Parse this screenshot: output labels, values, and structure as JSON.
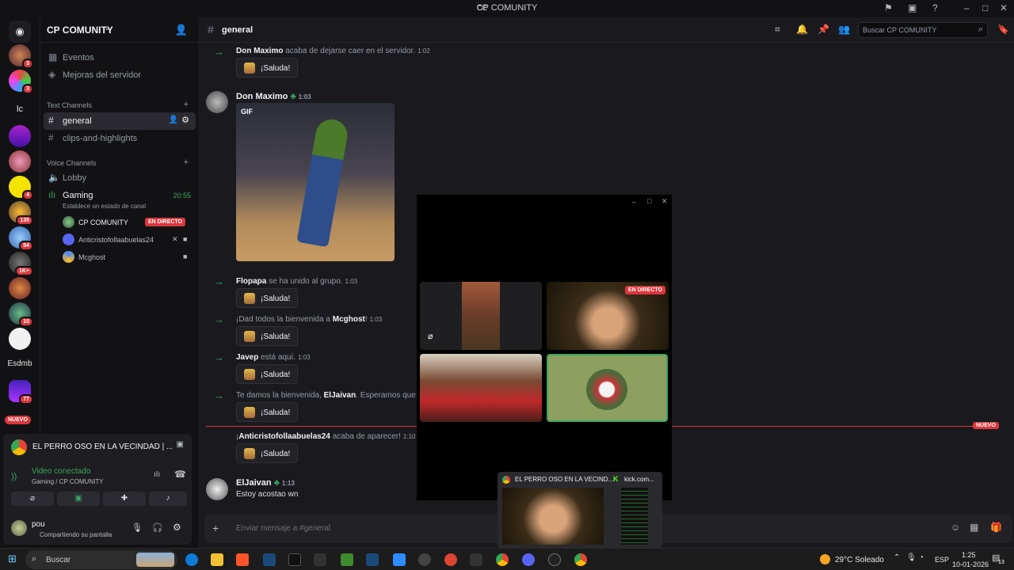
{
  "window": {
    "title": "CP COMUNITY"
  },
  "guilds": {
    "badges": [
      "3",
      "3",
      "4",
      "135",
      "54",
      "1K+",
      "10",
      "77"
    ],
    "text_items": [
      "lc",
      "Esdmb"
    ],
    "new_label": "NUEVO"
  },
  "server": {
    "name": "CP COMUNITY"
  },
  "sidebar": {
    "events": "Eventos",
    "boosts": "Mejoras del servidor",
    "text_category": "Text Channels",
    "text_channels": [
      "general",
      "clips-and-highlights"
    ],
    "voice_category": "Voice Channels",
    "voice_channels": [
      "Lobby",
      "Gaming"
    ],
    "gaming_timer": "20:55",
    "gaming_status": "Establece un estado de canal",
    "voice_users": [
      "CP COMUNITY",
      "Anticristofollaabuelas24",
      "Mcghost"
    ],
    "live_label": "EN DIRECTO"
  },
  "panel": {
    "activity_title": "EL PERRO OSO EN LA VECINDAD | ...",
    "voice_status": "Video conectado",
    "voice_channel": "Gaming / CP COMUNITY",
    "username": "pou",
    "user_status": "Compartiendo su pantalla"
  },
  "chat": {
    "channel": "general",
    "search_placeholder": "Buscar CP COMUNITY",
    "wave_label": "¡Saluda!",
    "gif_label": "GIF",
    "new_divider": "NUEVO",
    "messages": [
      {
        "author": "Don Maximo",
        "text": "acaba de dejarse caer en el servidor.",
        "time": "1:02"
      },
      {
        "author": "Don Maximo",
        "time": "1:03"
      },
      {
        "author": "Flopapa",
        "text": "se ha unido al grupo.",
        "time": "1:03"
      },
      {
        "prefix": "¡Dad todos la bienvenida a ",
        "author": "Mcghost",
        "suffix": "!",
        "time": "1:03"
      },
      {
        "author": "Javep",
        "text": "está aquí.",
        "time": "1:03"
      },
      {
        "prefix": "Te damos la bienvenida, ",
        "author": "ElJaivan",
        "suffix": ". Esperamos que t"
      },
      {
        "prefix": "¡",
        "author": "Anticristofollaabuelas24",
        "text": "acaba de aparecer!",
        "time": "1:10"
      },
      {
        "author": "ElJaivan",
        "time": "1:13",
        "body": "Estoy acostao wn"
      }
    ],
    "composer_placeholder": "Enviar mensaje a #general"
  },
  "popout": {
    "live_label": "EN DIRECTO"
  },
  "thumbnails": {
    "left_title": "EL PERRO OSO EN LA VECIND...",
    "right_title": "kick.com..."
  },
  "taskbar": {
    "search": "Buscar",
    "weather": "29°C  Soleado",
    "lang": "ESP",
    "time": "1:25",
    "date": "10-01-2026",
    "notif_count": "13"
  },
  "colors": {
    "accent_green": "#3ba55c",
    "live_red": "#da373c",
    "bg": "#1a1a1e"
  }
}
